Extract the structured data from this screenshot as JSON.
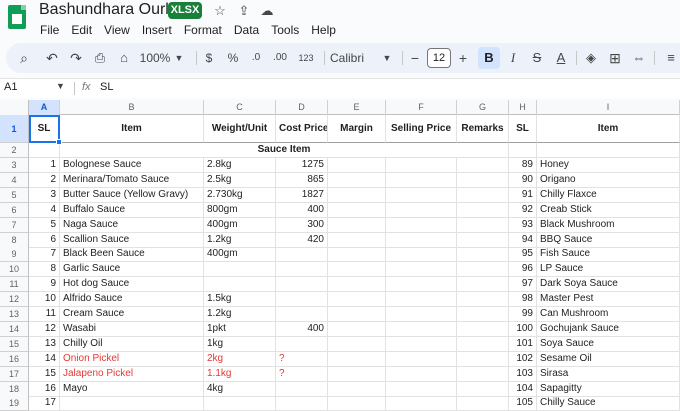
{
  "app": {
    "title": "Bashundhara Ourlet",
    "badge": "XLSX"
  },
  "menu": [
    "File",
    "Edit",
    "View",
    "Insert",
    "Format",
    "Data",
    "Tools",
    "Help"
  ],
  "toolbar": {
    "zoom": "100%",
    "currency": "$",
    "percent": "%",
    "decimal_dec": ".0",
    "decimal_inc": ".00",
    "number_format": "123",
    "font": "Calibri",
    "font_size": "12",
    "bold": "B",
    "italic": "I",
    "text_color": "A"
  },
  "formula_bar": {
    "cell_ref": "A1",
    "fx": "fx",
    "value": "SL"
  },
  "columns": [
    "A",
    "B",
    "C",
    "D",
    "E",
    "F",
    "G",
    "H",
    "I"
  ],
  "header_row": {
    "num": "1",
    "cells": [
      "SL",
      "Item",
      "Weight/Unit",
      "Cost Price",
      "Margin",
      "Selling Price",
      "Remarks",
      "SL",
      "Item"
    ]
  },
  "section_row": {
    "num": "2",
    "label": "Sauce Item"
  },
  "rows": [
    {
      "num": "3",
      "sl": "1",
      "item": "Bolognese Sauce",
      "weight": "2.8kg",
      "cost": "1275",
      "sl2": "89",
      "item2": "Honey"
    },
    {
      "num": "4",
      "sl": "2",
      "item": "Merinara/Tomato Sauce",
      "weight": "2.5kg",
      "cost": "865",
      "sl2": "90",
      "item2": "Origano"
    },
    {
      "num": "5",
      "sl": "3",
      "item": "Butter Sauce (Yellow Gravy)",
      "weight": "2.730kg",
      "cost": "1827",
      "sl2": "91",
      "item2": "Chilly Flaxce"
    },
    {
      "num": "6",
      "sl": "4",
      "item": "Buffalo Sauce",
      "weight": "800gm",
      "cost": "400",
      "sl2": "92",
      "item2": "Creab Stick"
    },
    {
      "num": "7",
      "sl": "5",
      "item": "Naga Sauce",
      "weight": "400gm",
      "cost": "300",
      "sl2": "93",
      "item2": "Black Mushroom"
    },
    {
      "num": "8",
      "sl": "6",
      "item": "Scallion Sauce",
      "weight": "1.2kg",
      "cost": "420",
      "sl2": "94",
      "item2": "BBQ Sauce"
    },
    {
      "num": "9",
      "sl": "7",
      "item": "Black Been Sauce",
      "weight": "400gm",
      "cost": "",
      "sl2": "95",
      "item2": "Fish Sauce"
    },
    {
      "num": "10",
      "sl": "8",
      "item": "Garlic Sauce",
      "weight": "",
      "cost": "",
      "sl2": "96",
      "item2": "LP Sauce"
    },
    {
      "num": "11",
      "sl": "9",
      "item": "Hot dog Sauce",
      "weight": "",
      "cost": "",
      "sl2": "97",
      "item2": "Dark Soya Sauce"
    },
    {
      "num": "12",
      "sl": "10",
      "item": "Alfrido Sauce",
      "weight": "1.5kg",
      "cost": "",
      "sl2": "98",
      "item2": "Master Pest"
    },
    {
      "num": "13",
      "sl": "11",
      "item": "Cream Sauce",
      "weight": "1.2kg",
      "cost": "",
      "sl2": "99",
      "item2": "Can Mushroom"
    },
    {
      "num": "14",
      "sl": "12",
      "item": "Wasabi",
      "weight": "1pkt",
      "cost": "400",
      "sl2": "100",
      "item2": "Gochujank Sauce"
    },
    {
      "num": "15",
      "sl": "13",
      "item": "Chilly Oil",
      "weight": "1kg",
      "cost": "",
      "sl2": "101",
      "item2": "Soya Sauce"
    },
    {
      "num": "16",
      "sl": "14",
      "item": "Onion Pickel",
      "weight": "2kg",
      "cost": "?",
      "sl2": "102",
      "item2": "Sesame Oil",
      "red": true
    },
    {
      "num": "17",
      "sl": "15",
      "item": "Jalapeno Pickel",
      "weight": "1.1kg",
      "cost": "?",
      "sl2": "103",
      "item2": "Sirasa",
      "red": true
    },
    {
      "num": "18",
      "sl": "16",
      "item": "Mayo",
      "weight": "4kg",
      "cost": "",
      "sl2": "104",
      "item2": "Sapagitty"
    },
    {
      "num": "19",
      "sl": "17",
      "item": "",
      "weight": "",
      "cost": "",
      "sl2": "105",
      "item2": "Chilly Sauce"
    }
  ],
  "colors": {
    "accent": "#1a73e8",
    "badge": "#188038",
    "red_text": "#e53935"
  }
}
